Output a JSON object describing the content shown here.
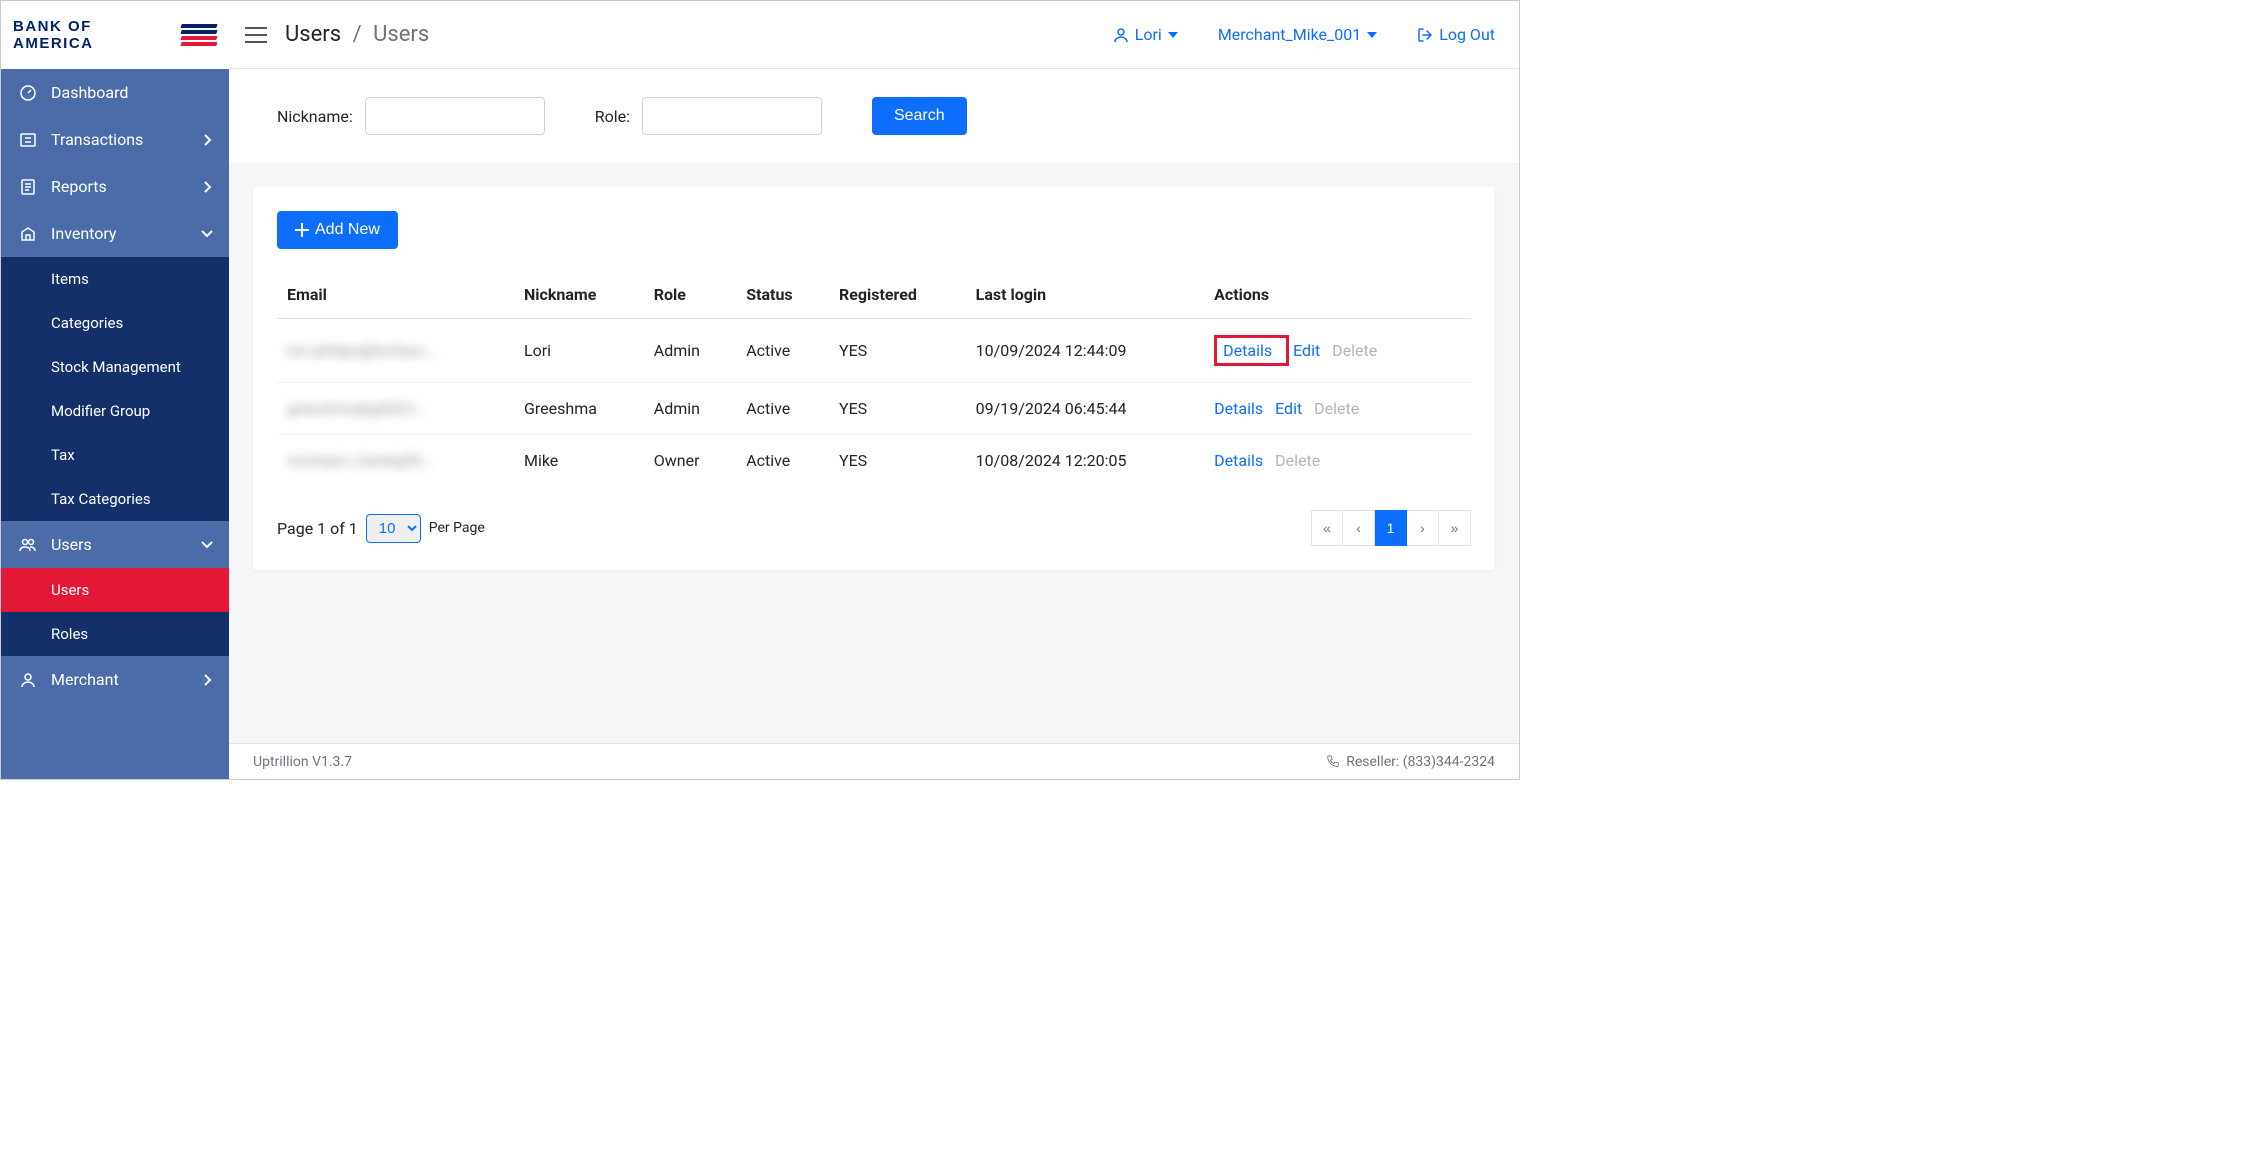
{
  "logo_text": "BANK OF AMERICA",
  "breadcrumb": {
    "root": "Users",
    "current": "Users"
  },
  "top": {
    "user": "Lori",
    "merchant": "Merchant_Mike_001",
    "logout": "Log Out"
  },
  "sidebar": {
    "items": [
      {
        "label": "Dashboard",
        "icon": "dashboard"
      },
      {
        "label": "Transactions",
        "icon": "transactions",
        "chev": "right"
      },
      {
        "label": "Reports",
        "icon": "reports",
        "chev": "right"
      },
      {
        "label": "Inventory",
        "icon": "inventory",
        "chev": "down",
        "sub": [
          {
            "label": "Items"
          },
          {
            "label": "Categories"
          },
          {
            "label": "Stock Management"
          },
          {
            "label": "Modifier Group"
          },
          {
            "label": "Tax"
          },
          {
            "label": "Tax Categories"
          }
        ]
      },
      {
        "label": "Users",
        "icon": "users",
        "chev": "down",
        "sub": [
          {
            "label": "Users",
            "active": true
          },
          {
            "label": "Roles"
          }
        ]
      },
      {
        "label": "Merchant",
        "icon": "merchant",
        "chev": "right"
      }
    ]
  },
  "filters": {
    "nickname_label": "Nickname:",
    "role_label": "Role:",
    "search_label": "Search"
  },
  "add_new_label": "Add New",
  "columns": [
    "Email",
    "Nickname",
    "Role",
    "Status",
    "Registered",
    "Last login",
    "Actions"
  ],
  "rows": [
    {
      "email": "lori.philips@bofaus...",
      "nickname": "Lori",
      "role": "Admin",
      "status": "Active",
      "registered": "YES",
      "last_login": "10/09/2024  12:44:09",
      "details": true,
      "edit": true,
      "delete": false,
      "highlight": true
    },
    {
      "email": "greeshma@gfd23...",
      "nickname": "Greeshma",
      "role": "Admin",
      "status": "Active",
      "registered": "YES",
      "last_login": "09/19/2024  06:45:44",
      "details": true,
      "edit": true,
      "delete": false
    },
    {
      "email": "michael.c.bank@fir...",
      "nickname": "Mike",
      "role": "Owner",
      "status": "Active",
      "registered": "YES",
      "last_login": "10/08/2024  12:20:05",
      "details": true,
      "edit": false,
      "delete": false
    }
  ],
  "actions": {
    "details": "Details",
    "edit": "Edit",
    "delete": "Delete"
  },
  "pagination": {
    "page_info": "Page 1 of 1",
    "per_page_value": "10",
    "per_page_label": "Per Page",
    "current_page": "1"
  },
  "footer": {
    "version": "Uptrillion V1.3.7",
    "reseller": "Reseller:  (833)344-2324"
  }
}
